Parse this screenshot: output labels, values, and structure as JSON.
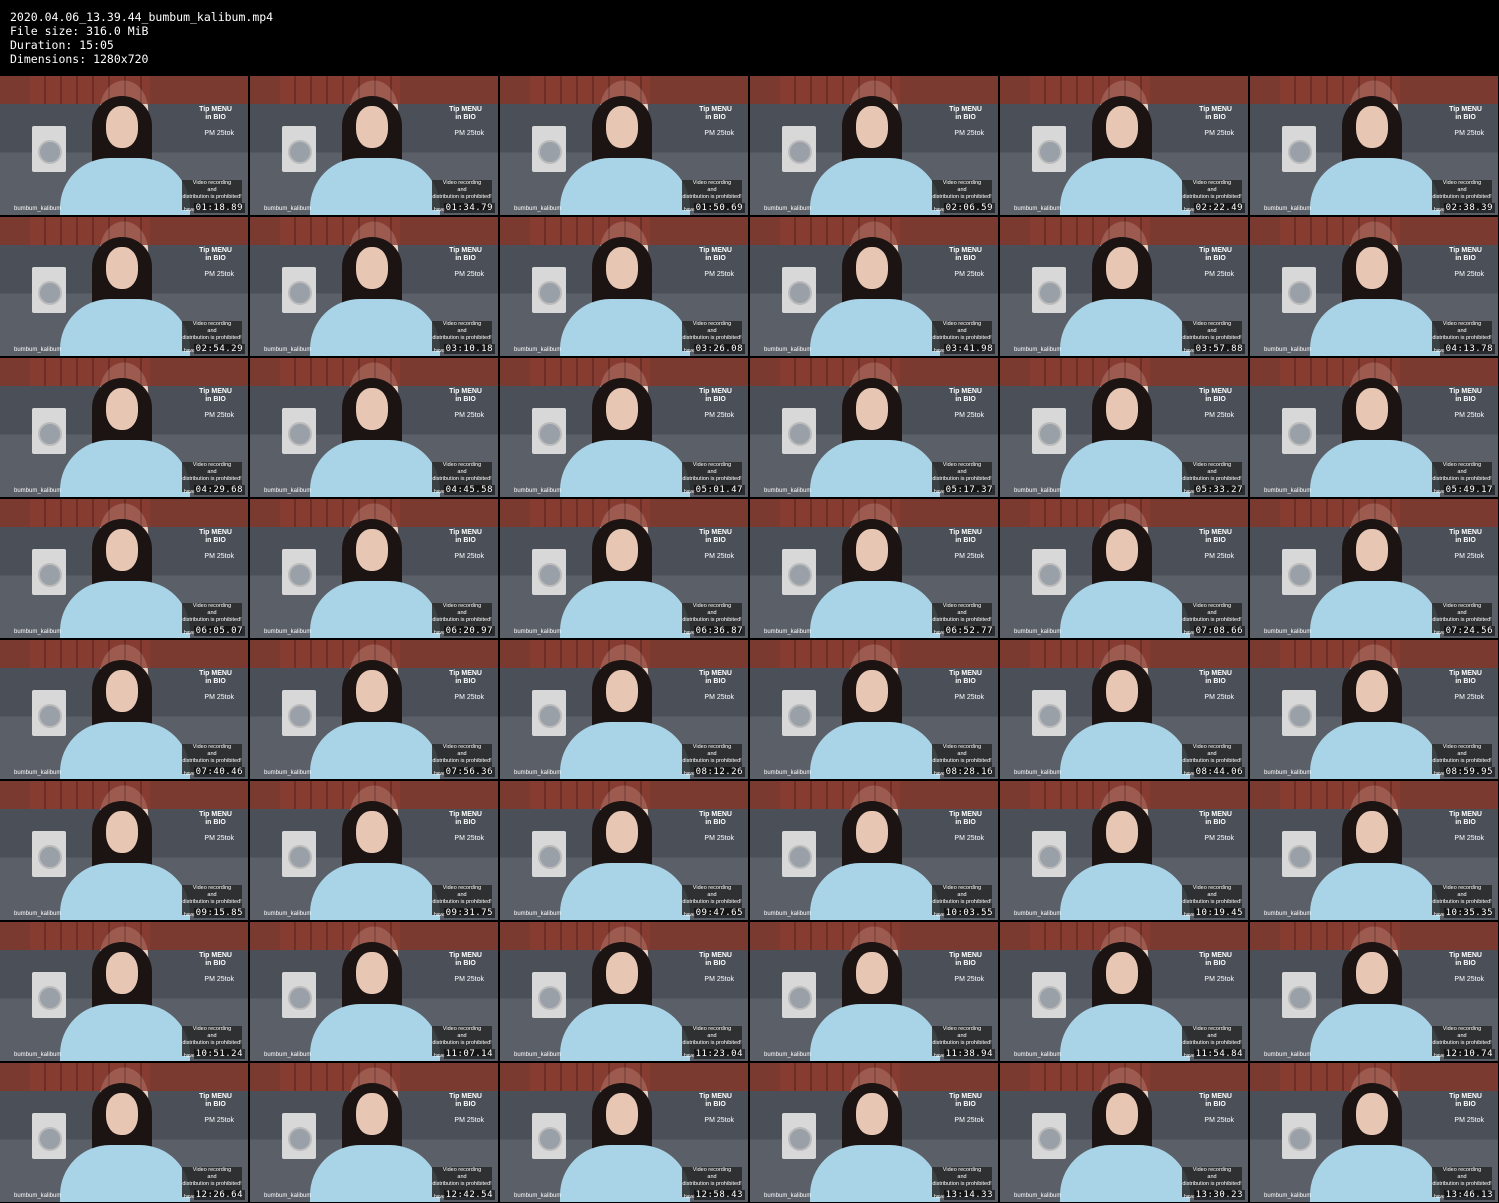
{
  "header": {
    "filename": "2020.04.06_13.39.44_bumbum_kalibum.mp4",
    "filesize": "File size: 316.0 MiB",
    "duration": "Duration: 15:05",
    "dimensions": "Dimensions: 1280x720"
  },
  "overlay": {
    "tip_line1": "Tip MENU",
    "tip_line2": "in BIO",
    "pm": "PM 25tok",
    "warning_line1": "Video recording",
    "warning_line2": "and",
    "warning_line3": "distribution is prohibited!",
    "username": "bumbum_kalibum",
    "have": "have"
  },
  "timestamps": [
    "01:18.89",
    "01:34.79",
    "01:50.69",
    "02:06.59",
    "02:22.49",
    "02:38.39",
    "02:54.29",
    "03:10.18",
    "03:26.08",
    "03:41.98",
    "03:57.88",
    "04:13.78",
    "04:29.68",
    "04:45.58",
    "05:01.47",
    "05:17.37",
    "05:33.27",
    "05:49.17",
    "06:05.07",
    "06:20.97",
    "06:36.87",
    "06:52.77",
    "07:08.66",
    "07:24.56",
    "07:40.46",
    "07:56.36",
    "08:12.26",
    "08:28.16",
    "08:44.06",
    "08:59.95",
    "09:15.85",
    "09:31.75",
    "09:47.65",
    "10:03.55",
    "10:19.45",
    "10:35.35",
    "10:51.24",
    "11:07.14",
    "11:23.04",
    "11:38.94",
    "11:54.84",
    "12:10.74",
    "12:26.64",
    "12:42.54",
    "12:58.43",
    "13:14.33",
    "13:30.23",
    "13:46.13"
  ]
}
